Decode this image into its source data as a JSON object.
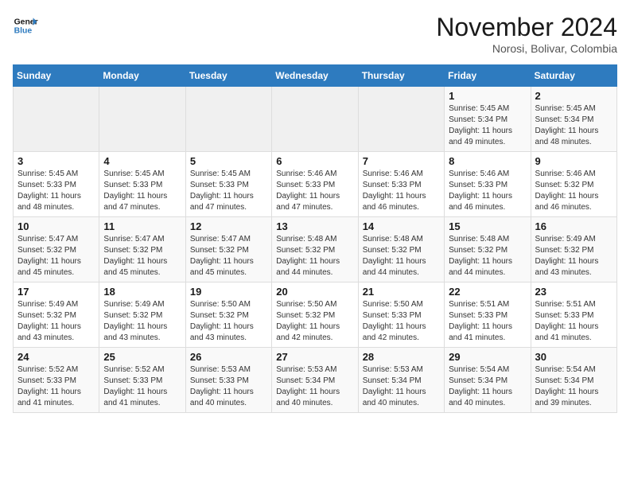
{
  "header": {
    "logo_line1": "General",
    "logo_line2": "Blue",
    "month": "November 2024",
    "location": "Norosi, Bolivar, Colombia"
  },
  "days_of_week": [
    "Sunday",
    "Monday",
    "Tuesday",
    "Wednesday",
    "Thursday",
    "Friday",
    "Saturday"
  ],
  "weeks": [
    [
      {
        "day": "",
        "info": ""
      },
      {
        "day": "",
        "info": ""
      },
      {
        "day": "",
        "info": ""
      },
      {
        "day": "",
        "info": ""
      },
      {
        "day": "",
        "info": ""
      },
      {
        "day": "1",
        "info": "Sunrise: 5:45 AM\nSunset: 5:34 PM\nDaylight: 11 hours and 49 minutes."
      },
      {
        "day": "2",
        "info": "Sunrise: 5:45 AM\nSunset: 5:34 PM\nDaylight: 11 hours and 48 minutes."
      }
    ],
    [
      {
        "day": "3",
        "info": "Sunrise: 5:45 AM\nSunset: 5:33 PM\nDaylight: 11 hours and 48 minutes."
      },
      {
        "day": "4",
        "info": "Sunrise: 5:45 AM\nSunset: 5:33 PM\nDaylight: 11 hours and 47 minutes."
      },
      {
        "day": "5",
        "info": "Sunrise: 5:45 AM\nSunset: 5:33 PM\nDaylight: 11 hours and 47 minutes."
      },
      {
        "day": "6",
        "info": "Sunrise: 5:46 AM\nSunset: 5:33 PM\nDaylight: 11 hours and 47 minutes."
      },
      {
        "day": "7",
        "info": "Sunrise: 5:46 AM\nSunset: 5:33 PM\nDaylight: 11 hours and 46 minutes."
      },
      {
        "day": "8",
        "info": "Sunrise: 5:46 AM\nSunset: 5:33 PM\nDaylight: 11 hours and 46 minutes."
      },
      {
        "day": "9",
        "info": "Sunrise: 5:46 AM\nSunset: 5:32 PM\nDaylight: 11 hours and 46 minutes."
      }
    ],
    [
      {
        "day": "10",
        "info": "Sunrise: 5:47 AM\nSunset: 5:32 PM\nDaylight: 11 hours and 45 minutes."
      },
      {
        "day": "11",
        "info": "Sunrise: 5:47 AM\nSunset: 5:32 PM\nDaylight: 11 hours and 45 minutes."
      },
      {
        "day": "12",
        "info": "Sunrise: 5:47 AM\nSunset: 5:32 PM\nDaylight: 11 hours and 45 minutes."
      },
      {
        "day": "13",
        "info": "Sunrise: 5:48 AM\nSunset: 5:32 PM\nDaylight: 11 hours and 44 minutes."
      },
      {
        "day": "14",
        "info": "Sunrise: 5:48 AM\nSunset: 5:32 PM\nDaylight: 11 hours and 44 minutes."
      },
      {
        "day": "15",
        "info": "Sunrise: 5:48 AM\nSunset: 5:32 PM\nDaylight: 11 hours and 44 minutes."
      },
      {
        "day": "16",
        "info": "Sunrise: 5:49 AM\nSunset: 5:32 PM\nDaylight: 11 hours and 43 minutes."
      }
    ],
    [
      {
        "day": "17",
        "info": "Sunrise: 5:49 AM\nSunset: 5:32 PM\nDaylight: 11 hours and 43 minutes."
      },
      {
        "day": "18",
        "info": "Sunrise: 5:49 AM\nSunset: 5:32 PM\nDaylight: 11 hours and 43 minutes."
      },
      {
        "day": "19",
        "info": "Sunrise: 5:50 AM\nSunset: 5:32 PM\nDaylight: 11 hours and 43 minutes."
      },
      {
        "day": "20",
        "info": "Sunrise: 5:50 AM\nSunset: 5:32 PM\nDaylight: 11 hours and 42 minutes."
      },
      {
        "day": "21",
        "info": "Sunrise: 5:50 AM\nSunset: 5:33 PM\nDaylight: 11 hours and 42 minutes."
      },
      {
        "day": "22",
        "info": "Sunrise: 5:51 AM\nSunset: 5:33 PM\nDaylight: 11 hours and 41 minutes."
      },
      {
        "day": "23",
        "info": "Sunrise: 5:51 AM\nSunset: 5:33 PM\nDaylight: 11 hours and 41 minutes."
      }
    ],
    [
      {
        "day": "24",
        "info": "Sunrise: 5:52 AM\nSunset: 5:33 PM\nDaylight: 11 hours and 41 minutes."
      },
      {
        "day": "25",
        "info": "Sunrise: 5:52 AM\nSunset: 5:33 PM\nDaylight: 11 hours and 41 minutes."
      },
      {
        "day": "26",
        "info": "Sunrise: 5:53 AM\nSunset: 5:33 PM\nDaylight: 11 hours and 40 minutes."
      },
      {
        "day": "27",
        "info": "Sunrise: 5:53 AM\nSunset: 5:34 PM\nDaylight: 11 hours and 40 minutes."
      },
      {
        "day": "28",
        "info": "Sunrise: 5:53 AM\nSunset: 5:34 PM\nDaylight: 11 hours and 40 minutes."
      },
      {
        "day": "29",
        "info": "Sunrise: 5:54 AM\nSunset: 5:34 PM\nDaylight: 11 hours and 40 minutes."
      },
      {
        "day": "30",
        "info": "Sunrise: 5:54 AM\nSunset: 5:34 PM\nDaylight: 11 hours and 39 minutes."
      }
    ]
  ]
}
